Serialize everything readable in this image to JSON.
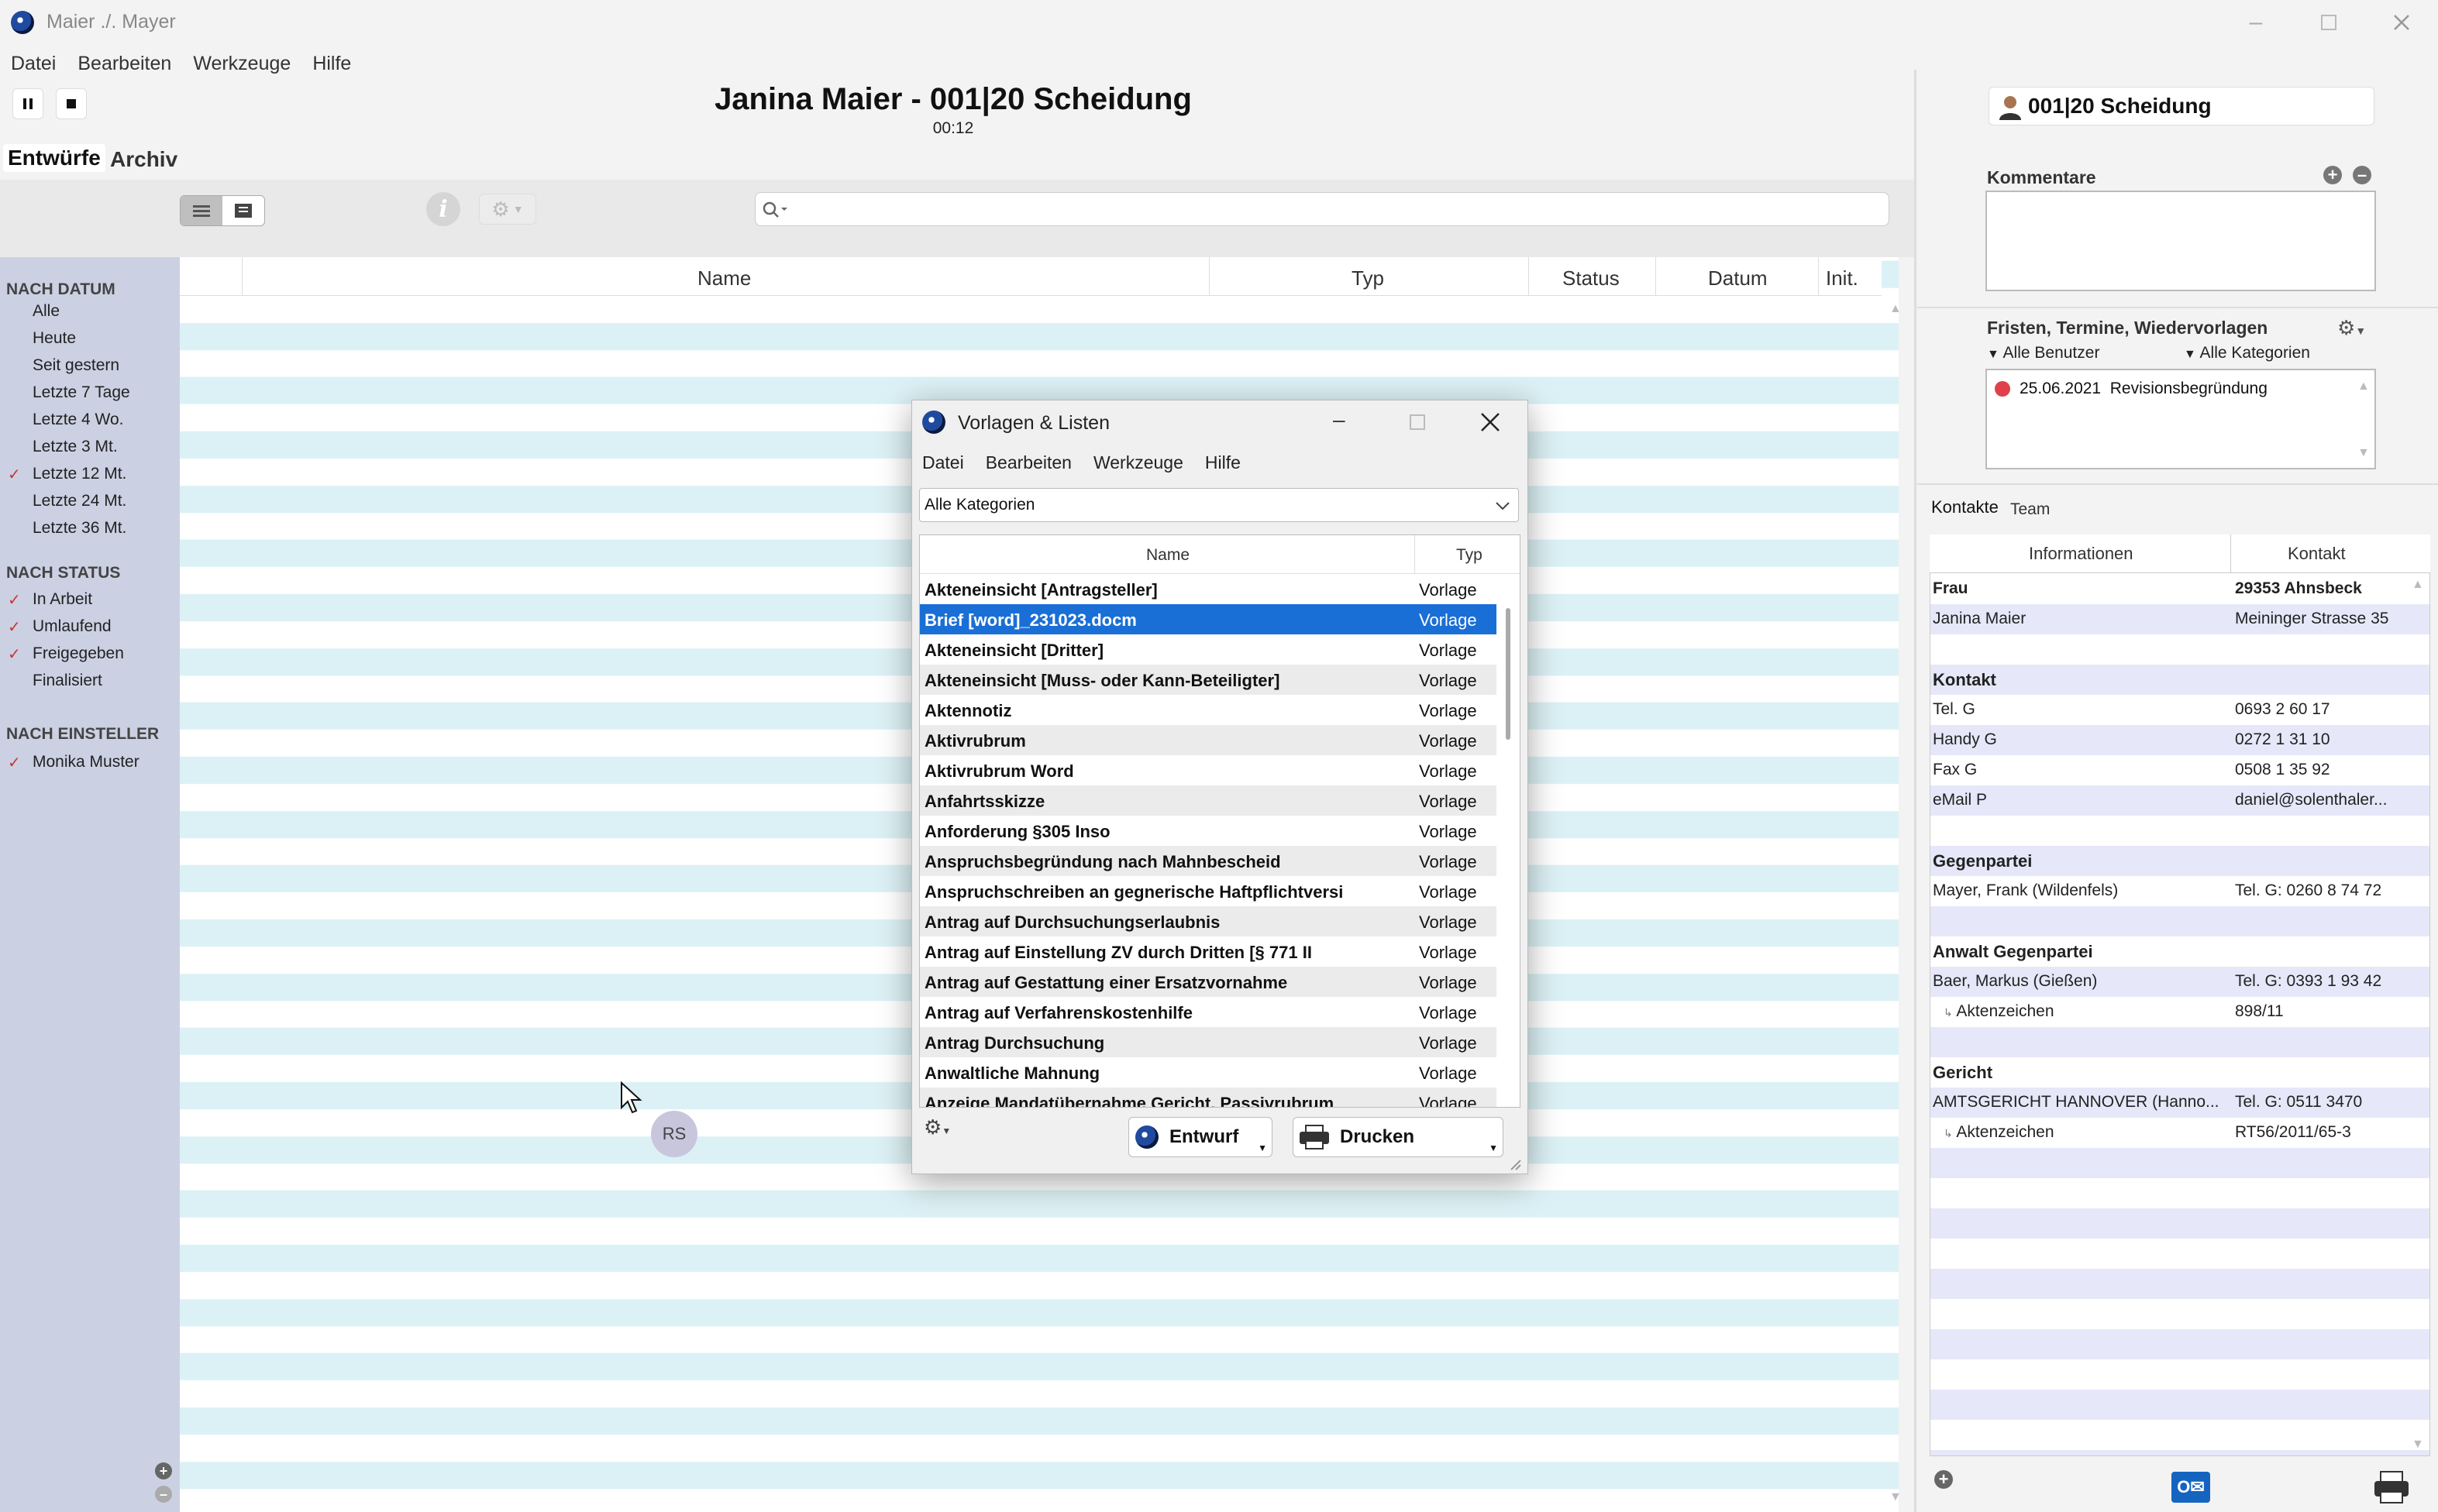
{
  "window": {
    "title": "Maier ./. Mayer"
  },
  "menu": [
    "Datei",
    "Bearbeiten",
    "Werkzeuge",
    "Hilfe"
  ],
  "header": {
    "case_title": "Janina Maier - 001|20 Scheidung",
    "timer": "00:12"
  },
  "tabs": {
    "entwuerfe": "Entwürfe",
    "archiv": "Archiv"
  },
  "sidebar": {
    "nach_datum": "NACH DATUM",
    "datum_items": [
      {
        "label": "Alle",
        "checked": false
      },
      {
        "label": "Heute",
        "checked": false
      },
      {
        "label": "Seit gestern",
        "checked": false
      },
      {
        "label": "Letzte 7 Tage",
        "checked": false
      },
      {
        "label": "Letzte 4 Wo.",
        "checked": false
      },
      {
        "label": "Letzte 3 Mt.",
        "checked": false
      },
      {
        "label": "Letzte 12 Mt.",
        "checked": true
      },
      {
        "label": "Letzte 24 Mt.",
        "checked": false
      },
      {
        "label": "Letzte 36 Mt.",
        "checked": false
      }
    ],
    "nach_status": "NACH STATUS",
    "status_items": [
      {
        "label": "In Arbeit",
        "checked": true
      },
      {
        "label": "Umlaufend",
        "checked": true
      },
      {
        "label": "Freigegeben",
        "checked": true
      },
      {
        "label": "Finalisiert",
        "checked": false
      }
    ],
    "nach_einsteller": "NACH EINSTELLER",
    "einsteller_items": [
      {
        "label": "Monika Muster",
        "checked": true
      }
    ]
  },
  "list": {
    "columns": {
      "name": "Name",
      "typ": "Typ",
      "status": "Status",
      "datum": "Datum",
      "init": "Init."
    }
  },
  "cursor_badge": "RS",
  "right": {
    "case_chip": "001|20 Scheidung",
    "kommentare": "Kommentare",
    "fristen": "Fristen, Termine, Wiedervorlagen",
    "alle_benutzer": "Alle Benutzer",
    "alle_kategorien": "Alle Kategorien",
    "frist_entry": "25.06.2021  Revisionsbegründung",
    "tabs": {
      "kontakte": "Kontakte",
      "team": "Team"
    },
    "contacts_head": {
      "informationen": "Informationen",
      "kontakt": "Kontakt"
    },
    "contacts": {
      "frau_left": "Frau",
      "frau_right": "29353 Ahnsbeck",
      "name_left": "Janina Maier",
      "name_right": "Meininger Strasse 35",
      "kontakt_sec": "Kontakt",
      "tel_left": "Tel. G",
      "tel_right": "0693 2 60 17",
      "handy_left": "Handy G",
      "handy_right": "0272 1 31 10",
      "fax_left": "Fax G",
      "fax_right": "0508 1 35 92",
      "mail_left": "eMail P",
      "mail_right": "daniel@solenthaler...",
      "gegen_sec": "Gegenpartei",
      "gegen_left": "Mayer, Frank (Wildenfels)",
      "gegen_right": "Tel. G: 0260 8 74 72",
      "anwalt_sec": "Anwalt Gegenpartei",
      "anwalt_left": "Baer, Markus (Gießen)",
      "anwalt_right": "Tel. G: 0393 1 93 42",
      "anwalt_az_left": "Aktenzeichen",
      "anwalt_az_right": "898/11",
      "gericht_sec": "Gericht",
      "gericht_left": "AMTSGERICHT HANNOVER (Hanno...",
      "gericht_right": "Tel. G: 0511 3470",
      "gericht_az_left": "Aktenzeichen",
      "gericht_az_right": "RT56/2011/65-3"
    }
  },
  "modal": {
    "title": "Vorlagen & Listen",
    "menu": [
      "Datei",
      "Bearbeiten",
      "Werkzeuge",
      "Hilfe"
    ],
    "category": "Alle Kategorien",
    "col_name": "Name",
    "col_typ": "Typ",
    "rows": [
      {
        "name": "Akteneinsicht [Antragsteller]",
        "typ": "Vorlage"
      },
      {
        "name": "Brief [word]_231023.docm",
        "typ": "Vorlage"
      },
      {
        "name": "Akteneinsicht [Dritter]",
        "typ": "Vorlage"
      },
      {
        "name": "Akteneinsicht [Muss- oder Kann-Beteiligter]",
        "typ": "Vorlage"
      },
      {
        "name": "Aktennotiz",
        "typ": "Vorlage"
      },
      {
        "name": "Aktivrubrum",
        "typ": "Vorlage"
      },
      {
        "name": "Aktivrubrum Word",
        "typ": "Vorlage"
      },
      {
        "name": "Anfahrtsskizze",
        "typ": "Vorlage"
      },
      {
        "name": "Anforderung §305 Inso",
        "typ": "Vorlage"
      },
      {
        "name": "Anspruchsbegründung nach Mahnbescheid",
        "typ": "Vorlage"
      },
      {
        "name": "Anspruchschreiben an gegnerische Haftpflichtversi",
        "typ": "Vorlage"
      },
      {
        "name": "Antrag auf Durchsuchungserlaubnis",
        "typ": "Vorlage"
      },
      {
        "name": "Antrag auf Einstellung ZV durch Dritten [§ 771 II",
        "typ": "Vorlage"
      },
      {
        "name": "Antrag auf Gestattung einer Ersatzvornahme",
        "typ": "Vorlage"
      },
      {
        "name": "Antrag auf Verfahrenskostenhilfe",
        "typ": "Vorlage"
      },
      {
        "name": "Antrag Durchsuchung",
        "typ": "Vorlage"
      },
      {
        "name": "Anwaltliche Mahnung",
        "typ": "Vorlage"
      },
      {
        "name": "Anzeige Mandatübernahme Gericht, Passivrubrum",
        "typ": "Vorlage"
      }
    ],
    "selected_index": 1,
    "btn_entwurf": "Entwurf",
    "btn_drucken": "Drucken"
  }
}
